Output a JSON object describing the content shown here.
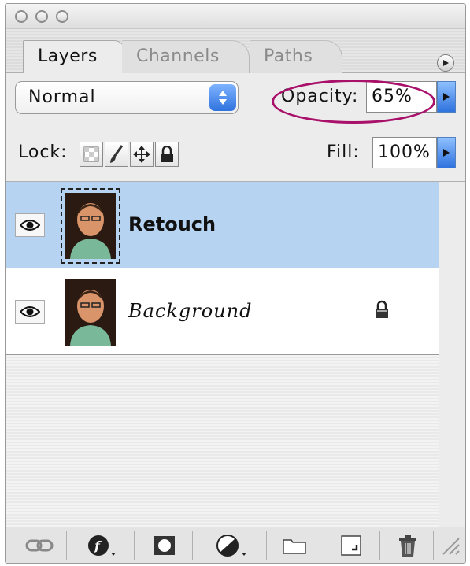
{
  "window": {
    "controls": [
      "close",
      "minimize",
      "zoom"
    ]
  },
  "tabs": [
    {
      "label": "Layers",
      "active": true
    },
    {
      "label": "Channels",
      "active": false
    },
    {
      "label": "Paths",
      "active": false
    }
  ],
  "blend_mode": {
    "value": "Normal"
  },
  "opacity": {
    "label": "Opacity:",
    "value": "65%"
  },
  "lock": {
    "label": "Lock:",
    "icons": [
      "transparency-lock-icon",
      "brush-lock-icon",
      "move-lock-icon",
      "padlock-icon"
    ]
  },
  "fill": {
    "label": "Fill:",
    "value": "100%"
  },
  "layers": [
    {
      "name": "Retouch",
      "selected": true,
      "visible": true,
      "locked": false
    },
    {
      "name": "Background",
      "selected": false,
      "visible": true,
      "locked": true
    }
  ],
  "footer_icons": [
    "link-icon",
    "layer-style-icon",
    "mask-icon",
    "adjustment-layer-icon",
    "folder-icon",
    "new-layer-icon",
    "trash-icon"
  ],
  "colors": {
    "selection": "#b7d3f2",
    "accent": "#2f73de",
    "highlight_oval": "#a8106a"
  }
}
